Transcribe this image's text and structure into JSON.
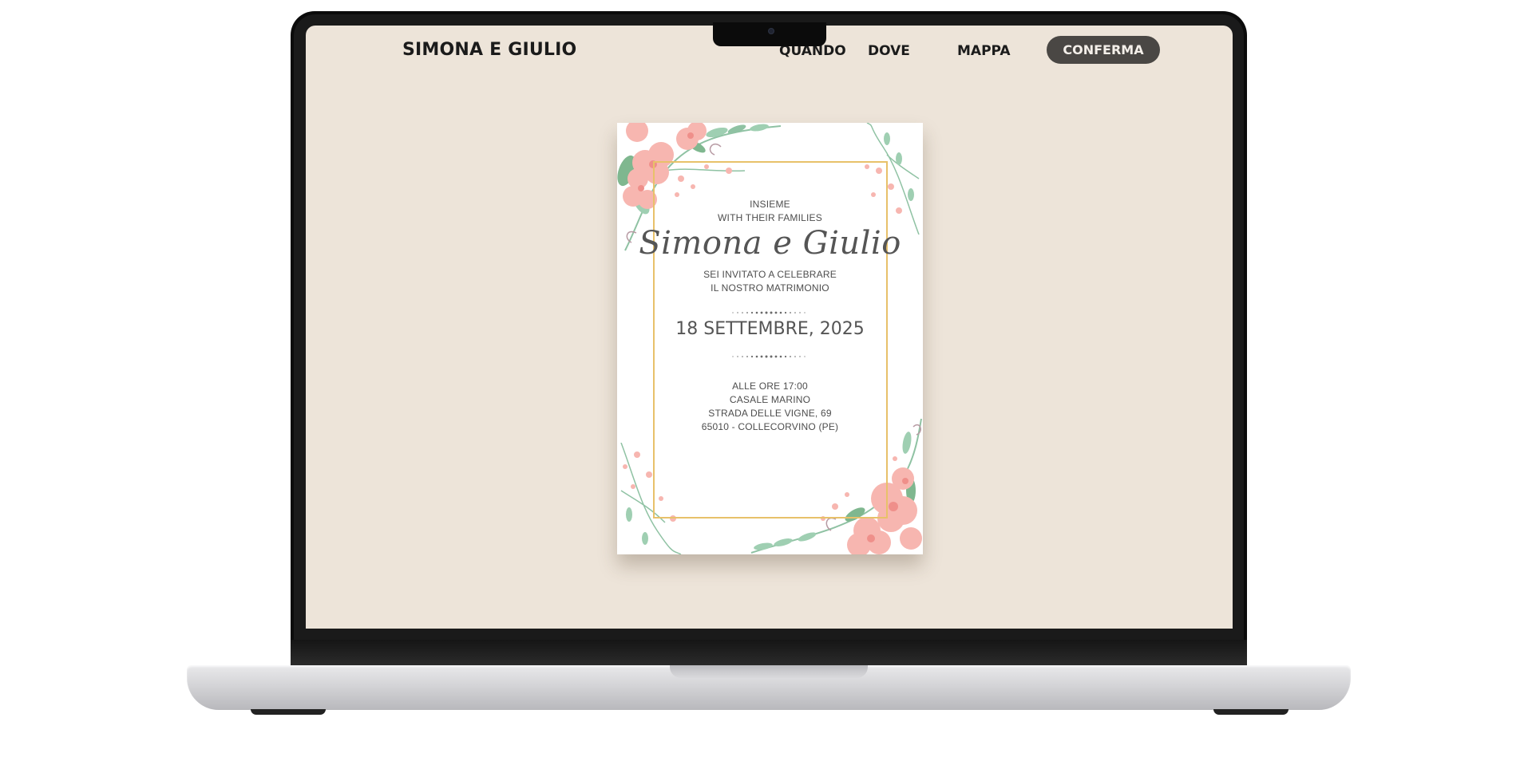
{
  "site": {
    "title": "SIMONA E GIULIO",
    "nav": {
      "quando": "QUANDO",
      "dove": "DOVE",
      "mappa": "MAPPA",
      "confirm": "CONFERMA"
    }
  },
  "invitation": {
    "line1": "INSIEME",
    "line2": "WITH THEIR FAMILIES",
    "names": "Simona e Giulio",
    "invite1": "SEI INVITATO A CELEBRARE",
    "invite2": "IL NOSTRO MATRIMONIO",
    "date": "18 SETTEMBRE, 2025",
    "time": "ALLE ORE 17:00",
    "venue": "CASALE MARINO",
    "street": "STRADA DELLE VIGNE, 69",
    "city": "65010 - COLLECORVINO (PE)"
  },
  "colors": {
    "screen_background": "#ede4d9",
    "button_background": "#4a4744",
    "frame_gold": "#e8c16a",
    "flower_pink": "#f7b6b0",
    "leaf_green": "#8fc2a3"
  }
}
